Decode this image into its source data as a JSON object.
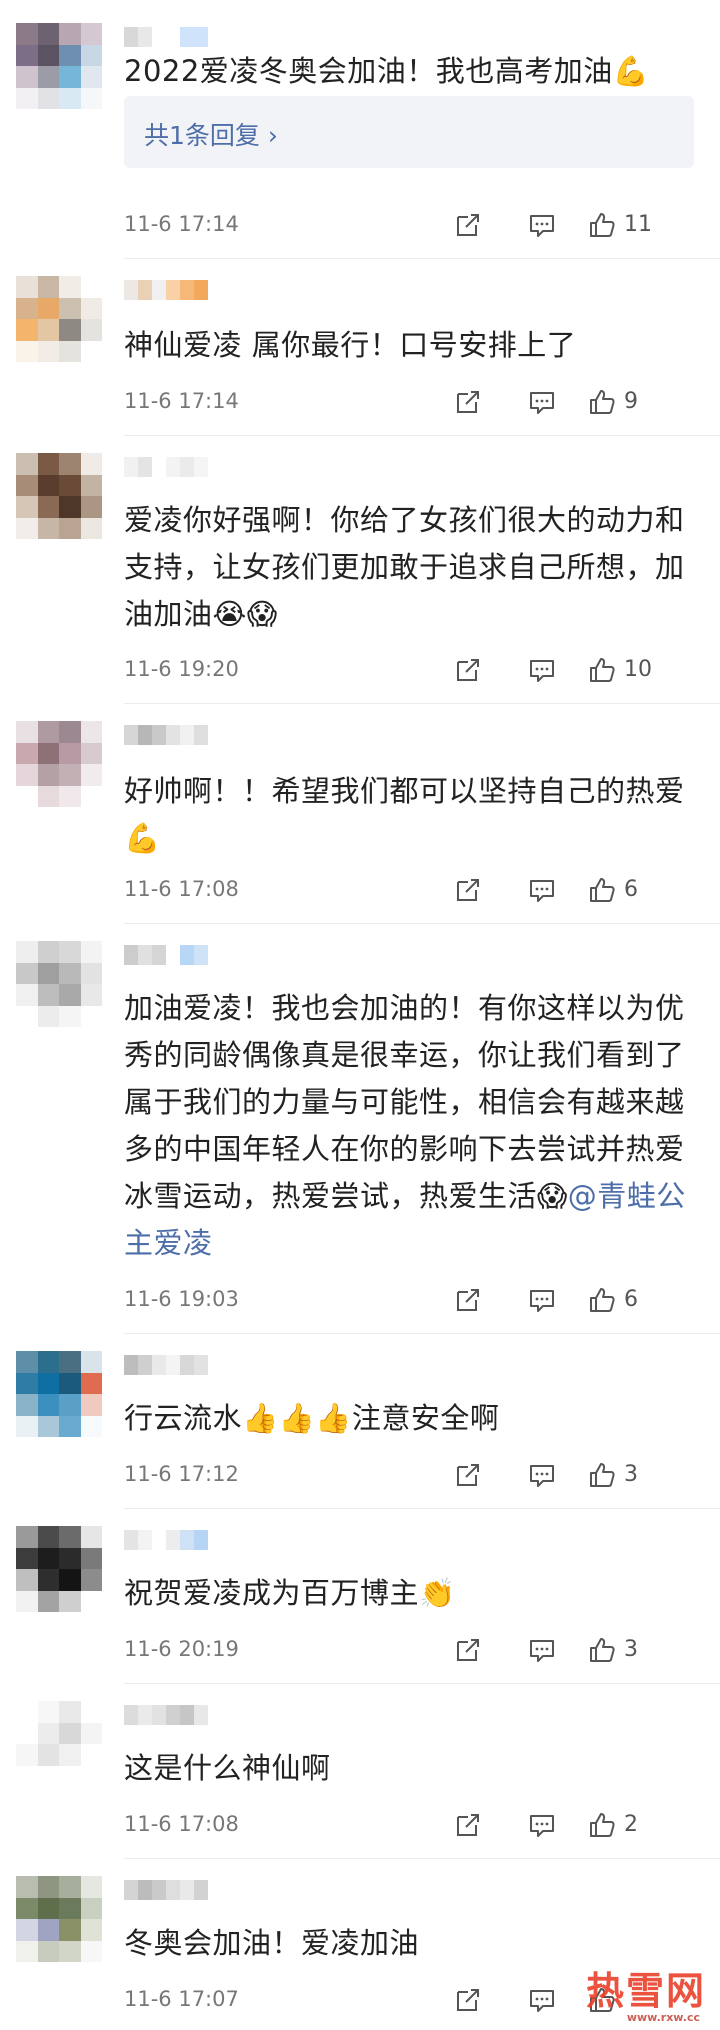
{
  "comments": [
    {
      "text": "2022爱凌冬奥会加油！我也高考加油💪",
      "replies_label": "共1条回复 ›",
      "time": "11-6 17:14",
      "likes": "11",
      "avatar": [
        "#8d7a88",
        "#6d6270",
        "#b9a6b3",
        "#d4c9d3",
        "#7c6e86",
        "#5b5362",
        "#6f8fb0",
        "#c7d7e6",
        "#cfc4cd",
        "#9c9ba8",
        "#76b6d8",
        "#e0e7ef",
        "#f2f0f2",
        "#e2e1e6",
        "#d9e9f3",
        "#f5f7f9"
      ],
      "name": [
        "#d8d8d8",
        "#e8e8e8",
        "#ffffff",
        "#ffffff",
        "#cfe4fb",
        "#cfe4fb"
      ]
    },
    {
      "text": "神仙爱凌 属你最行！口号安排上了",
      "time": "11-6 17:14",
      "likes": "9",
      "avatar": [
        "#e9e0d7",
        "#c9b7a6",
        "#f2ece6",
        "#ffffff",
        "#d7b28d",
        "#e8a868",
        "#ccc0b1",
        "#f0ebe4",
        "#f3b56b",
        "#e3c6a4",
        "#8e8a83",
        "#e5e3e0",
        "#faf3ea",
        "#f1ece6",
        "#e5e3de",
        "#ffffff"
      ],
      "name": [
        "#ece8e4",
        "#ead0b5",
        "#f0f0f0",
        "#f8d1a6",
        "#f5b878",
        "#f3a95c"
      ]
    },
    {
      "text": "爱凌你好强啊！你给了女孩们很大的动力和支持，让女孩们更加敢于追求自己所想，加油加油😭😱",
      "time": "11-6 19:20",
      "likes": "10",
      "avatar": [
        "#cbbfb2",
        "#7a5a45",
        "#9d8471",
        "#f0ebe6",
        "#a78c77",
        "#5a3d2c",
        "#6a4b38",
        "#c3b3a3",
        "#d5c6b6",
        "#8a6a55",
        "#4e3628",
        "#ab9684",
        "#f2ede8",
        "#c7b6a6",
        "#b8a491",
        "#ece6e0"
      ],
      "name": [
        "#f1f1f1",
        "#e4e4e4",
        "#ffffff",
        "#f3f3f3",
        "#ebebeb",
        "#f5f5f5"
      ]
    },
    {
      "text": "好帅啊！！希望我们都可以坚持自己的热爱💪",
      "time": "11-6 17:08",
      "likes": "6",
      "avatar": [
        "#e8e0e2",
        "#b09aa2",
        "#9c8890",
        "#ece6e8",
        "#c9a8b0",
        "#8e7077",
        "#b79aa3",
        "#d8cbcf",
        "#e4d6da",
        "#b4a1a6",
        "#c2b0b5",
        "#f1ebed",
        "#ffffff",
        "#e6dadd",
        "#f0e8ea",
        "#ffffff"
      ],
      "name": [
        "#d6d6d6",
        "#b7b7b7",
        "#c9c9c9",
        "#e3e3e3",
        "#f0f0f0",
        "#dedede"
      ]
    },
    {
      "text_parts": {
        "before": "加油爱凌！我也会加油的！有你这样以为优秀的同龄偶像真是很幸运，你让我们看到了属于我们的力量与可能性，相信会有越来越多的中国年轻人在你的影响下去尝试并热爱冰雪运动，热爱尝试，热爱生活😱",
        "mention": "@青蛙公主爱凌"
      },
      "time": "11-6 19:03",
      "likes": "6",
      "avatar": [
        "#eeeeee",
        "#cfcfcf",
        "#d8d8d8",
        "#f3f3f3",
        "#c8c8c8",
        "#9f9f9f",
        "#b9b9b9",
        "#e2e2e2",
        "#f0f0f0",
        "#bdbdbd",
        "#a9a9a9",
        "#e8e8e8",
        "#ffffff",
        "#ececec",
        "#f5f5f5",
        "#ffffff"
      ],
      "name": [
        "#cccccc",
        "#e0e0e0",
        "#d5d5d5",
        "#ffffff",
        "#b8d6f5",
        "#cfe3f8"
      ]
    },
    {
      "text": "行云流水👍👍👍注意安全啊",
      "time": "11-6 17:12",
      "likes": "3",
      "avatar": [
        "#5f8fa8",
        "#2b6f8d",
        "#4a6f83",
        "#d8e4ea",
        "#2f7da6",
        "#0f6fa3",
        "#1c5a7c",
        "#e06b4f",
        "#8ab3c8",
        "#3b90c0",
        "#5aa0c6",
        "#f0c9bf",
        "#e9f1f5",
        "#a8c7d8",
        "#6aaad0",
        "#f7fafc"
      ],
      "name": [
        "#bdbdbd",
        "#cfcfcf",
        "#e9e9e9",
        "#f4f4f4",
        "#d8d8d8",
        "#e2e2e2"
      ]
    },
    {
      "text": "祝贺爱凌成为百万博主👏",
      "time": "11-6 20:19",
      "likes": "3",
      "avatar": [
        "#9a9a9a",
        "#4b4b4b",
        "#6b6b6b",
        "#e6e6e6",
        "#3c3c3c",
        "#1d1d1d",
        "#2b2b2b",
        "#7a7a7a",
        "#bfbfbf",
        "#2e2e2e",
        "#141414",
        "#8c8c8c",
        "#f2f2f2",
        "#a3a3a3",
        "#cfcfcf",
        "#ffffff"
      ],
      "name": [
        "#e4e4e4",
        "#f3f3f3",
        "#ffffff",
        "#ededed",
        "#cfe2f5",
        "#b6d4f3"
      ]
    },
    {
      "text": "这是什么神仙啊",
      "time": "11-6 17:08",
      "likes": "2",
      "avatar": [
        "#ffffff",
        "#f7f7f7",
        "#e9e9e9",
        "#ffffff",
        "#ffffff",
        "#ececec",
        "#d8d8d8",
        "#f4f4f4",
        "#f6f6f6",
        "#e3e3e3",
        "#f0f0f0",
        "#ffffff",
        "#ffffff",
        "#ffffff",
        "#ffffff",
        "#ffffff"
      ],
      "name": [
        "#dcdcdc",
        "#eaeaea",
        "#e2e2e2",
        "#d0d0d0",
        "#c6c6c6",
        "#e8e8e8"
      ]
    },
    {
      "text": "冬奥会加油！爱凌加油",
      "time": "11-6 17:07",
      "likes": "",
      "avatar": [
        "#b8bdb0",
        "#8e9682",
        "#a7ae9c",
        "#e5e8e1",
        "#7c8a6a",
        "#5f6f4c",
        "#6b7a5a",
        "#c9cfc1",
        "#d3d6e2",
        "#9fa4c2",
        "#8a9166",
        "#dfe3d6",
        "#f0f1ec",
        "#c8ccbe",
        "#d2d6c9",
        "#f7f8f5"
      ],
      "name": [
        "#d4d4d4",
        "#bcbcbc",
        "#cacaca",
        "#dedede",
        "#e9e9e9",
        "#d2d2d2"
      ]
    }
  ],
  "watermark": {
    "main": "热雪网",
    "sub": "www.rxw.cc"
  },
  "colors": {
    "link": "#4d6ea8",
    "time": "#777777",
    "reply_bg": "#f1f3f6"
  }
}
